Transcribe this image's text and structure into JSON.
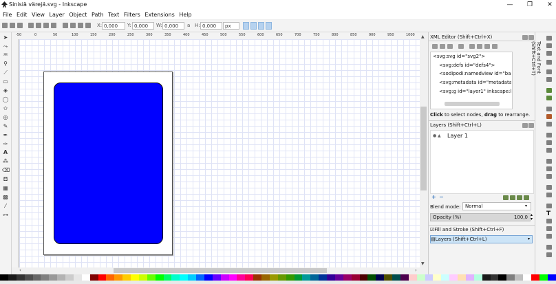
{
  "window": {
    "title": "Sinisiä värejä.svg - Inkscape",
    "minimize": "—",
    "maximize": "❐",
    "close": "✕"
  },
  "menu": [
    "File",
    "Edit",
    "View",
    "Layer",
    "Object",
    "Path",
    "Text",
    "Filters",
    "Extensions",
    "Help"
  ],
  "toolbar": {
    "x_label": "X:",
    "x_value": "0,000",
    "y_label": "Y:",
    "y_value": "0,000",
    "w_label": "W:",
    "w_value": "0,000",
    "lock_symbol": "a",
    "h_label": "H:",
    "h_value": "0,000",
    "unit": "px"
  },
  "ruler": {
    "top_labels": [
      "-50",
      "0",
      "50",
      "100",
      "150",
      "200",
      "250",
      "300",
      "350",
      "400",
      "450",
      "500",
      "550",
      "600",
      "650",
      "700",
      "750",
      "800",
      "850",
      "900",
      "950",
      "1000"
    ]
  },
  "xml_editor": {
    "title": "XML Editor (Shift+Ctrl+X)",
    "nodes": [
      "<svg:svg id=\"svg2\">",
      "<svg:defs id=\"defs4\">",
      "<sodipodi:namedview id=\"ba",
      "<svg:metadata id=\"metadata7",
      "<svg:g id=\"layer1\" inkscape:la"
    ],
    "hint_bold1": "Click",
    "hint_mid": " to select nodes, ",
    "hint_bold2": "drag",
    "hint_end": " to rearrange."
  },
  "layers": {
    "title": "Layers (Shift+Ctrl+L)",
    "items": [
      "Layer 1"
    ],
    "blend_label": "Blend mode:",
    "blend_value": "Normal",
    "opacity_label": "Opacity (%)",
    "opacity_value": "100,0"
  },
  "collapsed_panels": {
    "fill_stroke": "Fill and Stroke (Shift+Ctrl+F)",
    "layers_tab": "Layers (Shift+Ctrl+L)"
  },
  "vertical_tab": "Text and Font (Shift+Ctrl+T)",
  "colors": {
    "rect_fill": "#0000ff",
    "selected_tab": "#cce4f7"
  },
  "palette": [
    "#000000",
    "#1a1a1a",
    "#333333",
    "#4d4d4d",
    "#666666",
    "#808080",
    "#999999",
    "#b3b3b3",
    "#cccccc",
    "#e6e6e6",
    "#ffffff",
    "#800000",
    "#ff0000",
    "#ff6600",
    "#ff9900",
    "#ffcc00",
    "#ffff00",
    "#ccff00",
    "#66ff00",
    "#00ff00",
    "#00ff66",
    "#00ffcc",
    "#00ffff",
    "#00ccff",
    "#0066ff",
    "#0000ff",
    "#6600ff",
    "#cc00ff",
    "#ff00ff",
    "#ff0099",
    "#ff0055",
    "#993300",
    "#996600",
    "#999900",
    "#669900",
    "#339900",
    "#009933",
    "#009999",
    "#006699",
    "#003399",
    "#330099",
    "#660099",
    "#990066",
    "#990033",
    "#4d0000",
    "#004d00",
    "#00004d",
    "#4d4d00",
    "#004d4d",
    "#4d004d",
    "#ffcccc",
    "#ccffcc",
    "#ccccff",
    "#ffffcc",
    "#ccffff",
    "#ffccff",
    "#ffe0b3",
    "#e0b3ff",
    "#b3ffe0",
    "#1a1a1a",
    "#333333",
    "#000000",
    "#7f7f7f",
    "#bfbfbf",
    "#ffffff",
    "#ff0000",
    "#00ff00",
    "#0000ff"
  ]
}
